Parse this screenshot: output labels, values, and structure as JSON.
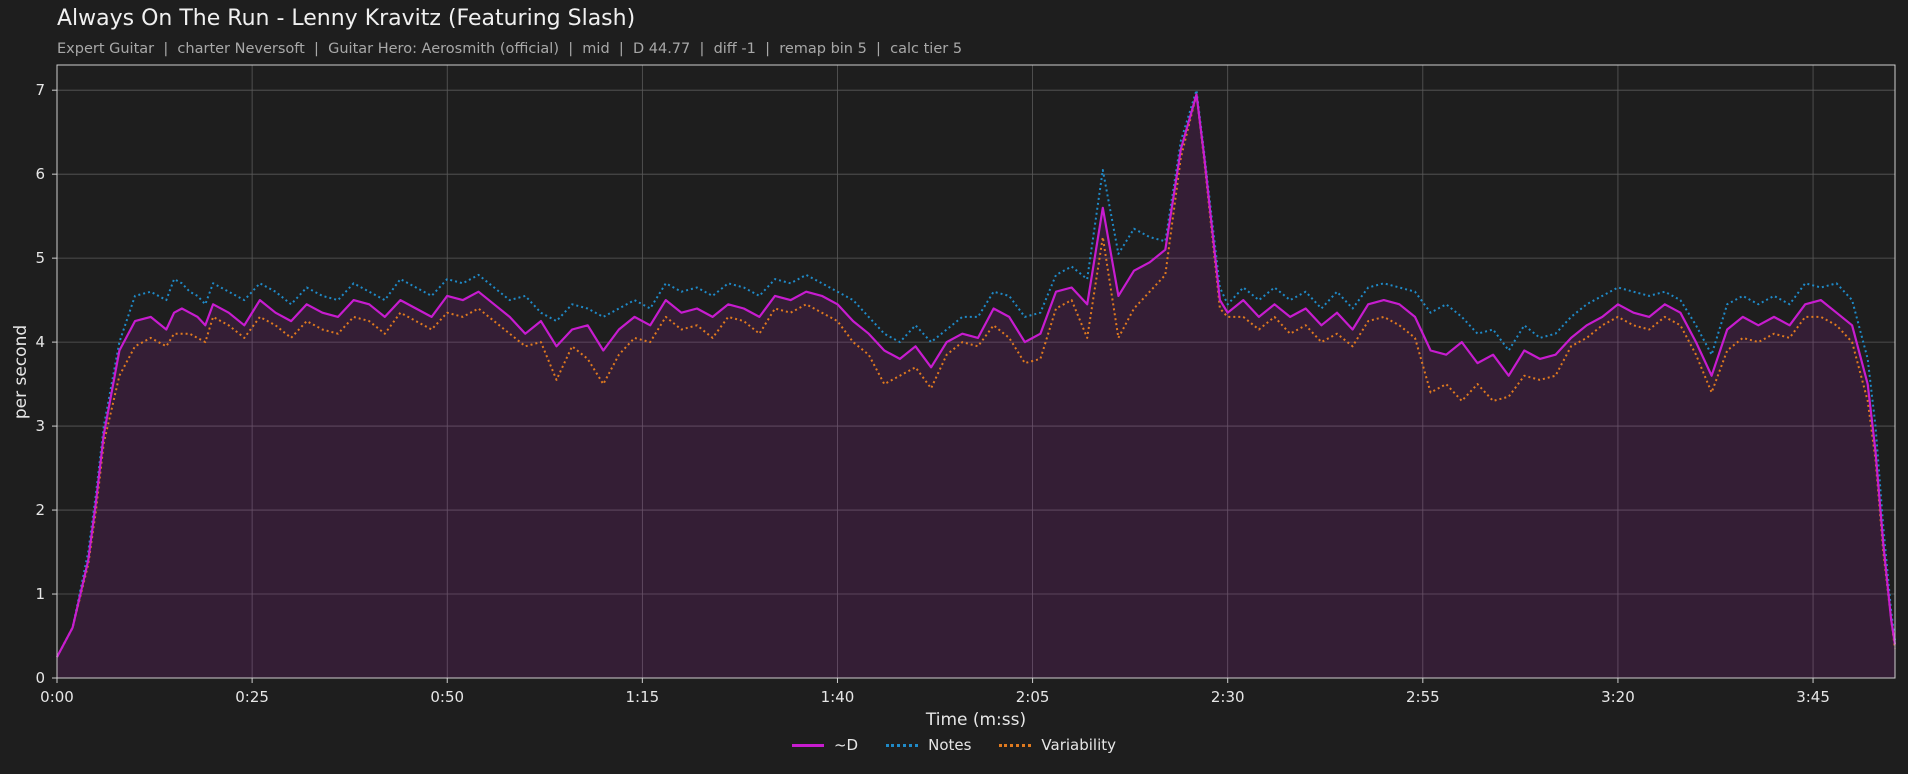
{
  "title": "Always On The Run - Lenny Kravitz (Featuring Slash)",
  "subtitle": "Expert Guitar  |  charter Neversoft  |  Guitar Hero: Aerosmith (official)  |  mid  |  D 44.77  |  diff -1  |  remap bin 5  |  calc tier 5",
  "colors": {
    "d": "#c71ccf",
    "notes": "#1f8ac8",
    "variability": "#e07a1f",
    "background": "#1e1e1e",
    "grid": "#5a5a5a"
  },
  "chart_data": {
    "type": "line",
    "xlabel": "Time (m:ss)",
    "ylabel": "per second",
    "xlim": [
      0,
      235.5
    ],
    "ylim": [
      0,
      7.3
    ],
    "xticks": [
      0,
      25,
      50,
      75,
      100,
      125,
      150,
      175,
      200,
      225
    ],
    "xticklabels": [
      "0:00",
      "0:25",
      "0:50",
      "1:15",
      "1:40",
      "2:05",
      "2:30",
      "2:55",
      "3:20",
      "3:45"
    ],
    "yticks": [
      0,
      1,
      2,
      3,
      4,
      5,
      6,
      7
    ],
    "grid": true,
    "legend": "bottom-center",
    "x": [
      0,
      2,
      4,
      5,
      6,
      8,
      10,
      12,
      14,
      15,
      16,
      17,
      18,
      19,
      20,
      22,
      24,
      26,
      28,
      30,
      32,
      34,
      36,
      38,
      40,
      42,
      44,
      46,
      48,
      50,
      52,
      54,
      56,
      58,
      60,
      62,
      64,
      66,
      68,
      70,
      72,
      74,
      76,
      78,
      80,
      82,
      84,
      86,
      88,
      90,
      92,
      94,
      96,
      98,
      100,
      102,
      104,
      106,
      108,
      110,
      112,
      114,
      116,
      118,
      120,
      122,
      124,
      126,
      128,
      130,
      132,
      134,
      136,
      138,
      140,
      142,
      144,
      146,
      147,
      149,
      150,
      152,
      154,
      156,
      158,
      160,
      162,
      164,
      166,
      168,
      170,
      172,
      174,
      176,
      178,
      180,
      182,
      184,
      186,
      188,
      190,
      192,
      194,
      196,
      198,
      200,
      202,
      204,
      206,
      208,
      210,
      212,
      214,
      216,
      218,
      220,
      222,
      224,
      226,
      228,
      230,
      232,
      233,
      234,
      235,
      235.5
    ],
    "series": [
      {
        "name": "~D",
        "values": [
          0.25,
          0.6,
          1.4,
          2.1,
          2.9,
          3.9,
          4.25,
          4.3,
          4.15,
          4.35,
          4.4,
          4.35,
          4.3,
          4.2,
          4.45,
          4.35,
          4.2,
          4.5,
          4.35,
          4.25,
          4.45,
          4.35,
          4.3,
          4.5,
          4.45,
          4.3,
          4.5,
          4.4,
          4.3,
          4.55,
          4.5,
          4.6,
          4.45,
          4.3,
          4.1,
          4.25,
          3.95,
          4.15,
          4.2,
          3.9,
          4.15,
          4.3,
          4.2,
          4.5,
          4.35,
          4.4,
          4.3,
          4.45,
          4.4,
          4.3,
          4.55,
          4.5,
          4.6,
          4.55,
          4.45,
          4.25,
          4.1,
          3.9,
          3.8,
          3.95,
          3.7,
          4.0,
          4.1,
          4.05,
          4.4,
          4.3,
          4.0,
          4.1,
          4.6,
          4.65,
          4.45,
          5.6,
          4.55,
          4.85,
          4.95,
          5.1,
          6.3,
          6.95,
          6.2,
          4.5,
          4.35,
          4.5,
          4.3,
          4.45,
          4.3,
          4.4,
          4.2,
          4.35,
          4.15,
          4.45,
          4.5,
          4.45,
          4.3,
          3.9,
          3.85,
          4.0,
          3.75,
          3.85,
          3.6,
          3.9,
          3.8,
          3.85,
          4.05,
          4.2,
          4.3,
          4.45,
          4.35,
          4.3,
          4.45,
          4.35,
          4.0,
          3.6,
          4.15,
          4.3,
          4.2,
          4.3,
          4.2,
          4.45,
          4.5,
          4.35,
          4.2,
          3.5,
          2.7,
          1.6,
          0.7,
          0.4
        ]
      },
      {
        "name": "Notes",
        "values": [
          0.25,
          0.6,
          1.5,
          2.2,
          3.0,
          4.0,
          4.55,
          4.6,
          4.5,
          4.75,
          4.7,
          4.6,
          4.55,
          4.45,
          4.7,
          4.6,
          4.5,
          4.7,
          4.6,
          4.45,
          4.65,
          4.55,
          4.5,
          4.7,
          4.6,
          4.5,
          4.75,
          4.65,
          4.55,
          4.75,
          4.7,
          4.8,
          4.65,
          4.5,
          4.55,
          4.35,
          4.25,
          4.45,
          4.4,
          4.3,
          4.4,
          4.5,
          4.4,
          4.7,
          4.6,
          4.65,
          4.55,
          4.7,
          4.65,
          4.55,
          4.75,
          4.7,
          4.8,
          4.7,
          4.6,
          4.5,
          4.3,
          4.1,
          4.0,
          4.2,
          4.0,
          4.15,
          4.3,
          4.3,
          4.6,
          4.55,
          4.3,
          4.35,
          4.8,
          4.9,
          4.75,
          6.05,
          5.05,
          5.35,
          5.25,
          5.2,
          6.4,
          7.0,
          6.25,
          4.65,
          4.45,
          4.65,
          4.5,
          4.65,
          4.5,
          4.6,
          4.4,
          4.6,
          4.4,
          4.65,
          4.7,
          4.65,
          4.6,
          4.35,
          4.45,
          4.3,
          4.1,
          4.15,
          3.9,
          4.2,
          4.05,
          4.1,
          4.3,
          4.45,
          4.55,
          4.65,
          4.6,
          4.55,
          4.6,
          4.5,
          4.2,
          3.85,
          4.45,
          4.55,
          4.45,
          4.55,
          4.45,
          4.7,
          4.65,
          4.7,
          4.5,
          3.8,
          3.0,
          1.8,
          0.8,
          0.45
        ]
      },
      {
        "name": "Variability",
        "values": [
          0.25,
          0.6,
          1.35,
          2.0,
          2.8,
          3.6,
          3.95,
          4.05,
          3.95,
          4.1,
          4.1,
          4.1,
          4.05,
          4.0,
          4.3,
          4.2,
          4.05,
          4.3,
          4.2,
          4.05,
          4.25,
          4.15,
          4.1,
          4.3,
          4.25,
          4.1,
          4.35,
          4.25,
          4.15,
          4.35,
          4.3,
          4.4,
          4.25,
          4.1,
          3.95,
          4.0,
          3.55,
          3.95,
          3.8,
          3.5,
          3.85,
          4.05,
          4.0,
          4.3,
          4.15,
          4.2,
          4.05,
          4.3,
          4.25,
          4.1,
          4.4,
          4.35,
          4.45,
          4.35,
          4.25,
          4.0,
          3.85,
          3.5,
          3.6,
          3.7,
          3.45,
          3.85,
          4.0,
          3.95,
          4.2,
          4.05,
          3.75,
          3.8,
          4.4,
          4.5,
          4.05,
          5.25,
          4.05,
          4.4,
          4.6,
          4.8,
          6.2,
          6.95,
          6.15,
          4.4,
          4.3,
          4.3,
          4.15,
          4.3,
          4.1,
          4.2,
          4.0,
          4.1,
          3.95,
          4.25,
          4.3,
          4.2,
          4.05,
          3.4,
          3.5,
          3.3,
          3.5,
          3.3,
          3.35,
          3.6,
          3.55,
          3.6,
          3.95,
          4.05,
          4.2,
          4.3,
          4.2,
          4.15,
          4.3,
          4.2,
          3.85,
          3.4,
          3.9,
          4.05,
          4.0,
          4.1,
          4.05,
          4.3,
          4.3,
          4.2,
          4.0,
          3.3,
          2.6,
          1.5,
          0.7,
          0.35
        ]
      }
    ]
  }
}
